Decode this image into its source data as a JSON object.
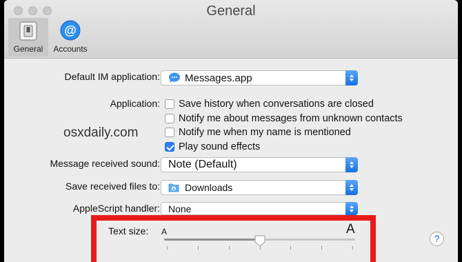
{
  "window": {
    "title": "General"
  },
  "toolbar": {
    "items": [
      {
        "label": "General",
        "icon": "general-switch-icon",
        "selected": true
      },
      {
        "label": "Accounts",
        "icon": "at-sign-icon",
        "selected": false
      }
    ]
  },
  "settings": {
    "default_im": {
      "label": "Default IM application:",
      "value": "Messages.app",
      "icon": "messages-app-icon"
    },
    "application": {
      "label": "Application:",
      "options": [
        {
          "label": "Save history when conversations are closed",
          "checked": false
        },
        {
          "label": "Notify me about messages from unknown contacts",
          "checked": false
        },
        {
          "label": "Notify me when my name is mentioned",
          "checked": false
        },
        {
          "label": "Play sound effects",
          "checked": true
        }
      ]
    },
    "message_sound": {
      "label": "Message received sound:",
      "value": "Note (Default)"
    },
    "save_files": {
      "label": "Save received files to:",
      "value": "Downloads",
      "icon": "downloads-folder-icon"
    },
    "applescript": {
      "label": "AppleScript handler:",
      "value": "None"
    },
    "text_size": {
      "label": "Text size:",
      "small_glyph": "A",
      "large_glyph": "A",
      "level_fraction": 0.5,
      "ticks": 7
    }
  },
  "watermark": "osxdaily.com",
  "help": {
    "glyph": "?"
  },
  "colors": {
    "accent": "#2d7ff2",
    "highlight_box": "#e81a1a"
  }
}
